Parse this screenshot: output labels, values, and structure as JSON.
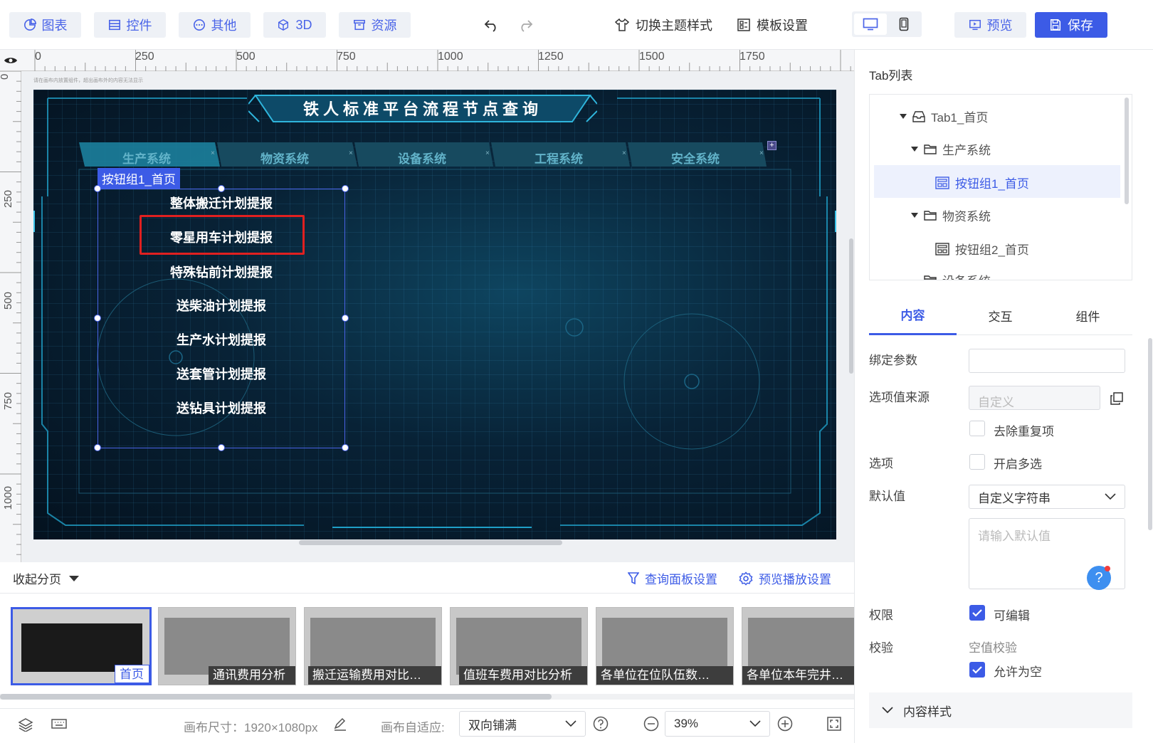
{
  "toolbar": {
    "chart": "图表",
    "controls": "控件",
    "other": "其他",
    "three_d": "3D",
    "resources": "资源",
    "switch_theme": "切换主题样式",
    "template_settings": "模板设置",
    "preview": "预览",
    "save": "保存"
  },
  "ruler": {
    "top": [
      "0",
      "250",
      "500",
      "750",
      "1000",
      "1250",
      "1500",
      "1750"
    ],
    "left": [
      "0",
      "250",
      "500",
      "750",
      "1000"
    ]
  },
  "canvas": {
    "hint": "请在画布内放置组件，超出画布外的内容无法显示",
    "title": "铁人标准平台流程节点查询",
    "tabs": [
      "生产系统",
      "物资系统",
      "设备系统",
      "工程系统",
      "安全系统"
    ],
    "selection_label": "按钮组1_首页",
    "buttons": [
      "整体搬迁计划提报",
      "零星用车计划提报",
      "特殊钻前计划提报",
      "送柴油计划提报",
      "生产水计划提报",
      "送套管计划提报",
      "送钻具计划提报"
    ]
  },
  "pages": {
    "collapse": "收起分页",
    "query_settings": "查询面板设置",
    "playback_settings": "预览播放设置",
    "thumbs": [
      "首页",
      "通讯费用分析",
      "搬迁运输费用对比…",
      "值班车费用对比分析",
      "各单位在位队伍数…",
      "各单位本年完井数…"
    ]
  },
  "statusbar": {
    "canvas_size_label": "画布尺寸：1920×1080px",
    "fit_label": "画布自适应:",
    "fit_value": "双向铺满",
    "zoom": "39%"
  },
  "panel": {
    "tab_list_title": "Tab列表",
    "tree": {
      "tab1": "Tab1_首页",
      "prod": "生产系统",
      "btn1": "按钮组1_首页",
      "mat": "物资系统",
      "btn2": "按钮组2_首页",
      "equip": "设备系统"
    },
    "tabs": {
      "content": "内容",
      "interact": "交互",
      "component": "组件"
    },
    "bind_param": "绑定参数",
    "option_source": "选项值来源",
    "option_source_placeholder": "自定义",
    "dedupe": "去除重复项",
    "options": "选项",
    "multi": "开启多选",
    "default": "默认值",
    "default_type": "自定义字符串",
    "default_placeholder": "请输入默认值",
    "permission": "权限",
    "editable": "可编辑",
    "validate": "校验",
    "null_check": "空值校验",
    "allow_null": "允许为空",
    "content_style": "内容样式"
  },
  "colors": {
    "accent": "#3c5be6",
    "screen_bg": "#082236",
    "highlight_red": "#e02020"
  }
}
